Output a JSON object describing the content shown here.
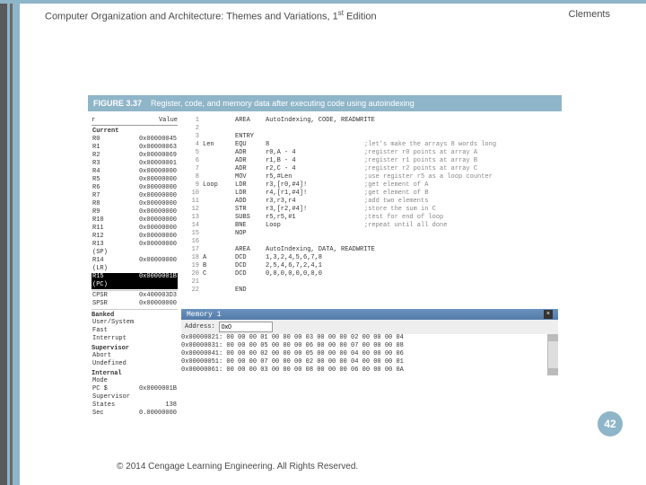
{
  "header": {
    "title_pre": "Computer Organization and Architecture: Themes and Variations, 1",
    "title_post": " Edition",
    "sup": "st",
    "author": "Clements"
  },
  "figure": {
    "number": "FIGURE 3.37",
    "caption": "Register, code, and memory data after executing code using autoindexing"
  },
  "registers": {
    "header_left": "r",
    "header_right": "Value",
    "group": "Current",
    "rows": [
      {
        "n": "R0",
        "v": "0x00000045"
      },
      {
        "n": "R1",
        "v": "0x00000063"
      },
      {
        "n": "R2",
        "v": "0x00000069"
      },
      {
        "n": "R3",
        "v": "0x00000001"
      },
      {
        "n": "R4",
        "v": "0x00000000"
      },
      {
        "n": "R5",
        "v": "0x00000000"
      },
      {
        "n": "R6",
        "v": "0x00000000"
      },
      {
        "n": "R7",
        "v": "0x00000000"
      },
      {
        "n": "R8",
        "v": "0x00000000"
      },
      {
        "n": "R9",
        "v": "0x00000000"
      },
      {
        "n": "R10",
        "v": "0x00000000"
      },
      {
        "n": "R11",
        "v": "0x00000000"
      },
      {
        "n": "R12",
        "v": "0x00000000"
      },
      {
        "n": "R13 (SP)",
        "v": "0x00000000"
      },
      {
        "n": "R14 (LR)",
        "v": "0x00000000"
      }
    ],
    "hl_row": {
      "n": "R15 (PC)",
      "v": "0x0000001B"
    },
    "cpsr": {
      "n": "CPSR",
      "v": "0x400003D3"
    },
    "spsr": {
      "n": "SPSR",
      "v": "0x00000000"
    },
    "banked": "Banked",
    "usersys": "User/System",
    "fastint": "Fast Interrupt",
    "supervisor_hdr": "Supervisor",
    "abort": "Abort",
    "undef": "Undefined",
    "internal": "Internal",
    "int_rows": [
      {
        "n": "Mode",
        "v": ""
      },
      {
        "n": "PC $",
        "v": "0x0000001B"
      },
      {
        "n": "Supervisor",
        "v": ""
      },
      {
        "n": "States",
        "v": "138"
      },
      {
        "n": "Sec",
        "v": "0.00000000"
      }
    ]
  },
  "line_nums": [
    "1",
    "2",
    "3",
    "4",
    "5",
    "6",
    "7",
    "8",
    "9",
    "10",
    "11",
    "12",
    "13",
    "14",
    "15",
    "16",
    "17",
    "18",
    "19",
    "20",
    "21",
    "22"
  ],
  "code": [
    {
      "lbl": "",
      "mn": "AREA",
      "op": "AutoIndexing, CODE, READWRITE",
      "cm": ""
    },
    {
      "lbl": "",
      "mn": "",
      "op": "",
      "cm": ""
    },
    {
      "lbl": "",
      "mn": "ENTRY",
      "op": "",
      "cm": ""
    },
    {
      "lbl": "Len",
      "mn": "EQU",
      "op": "8",
      "cm": ";let's make the arrays 8 words long"
    },
    {
      "lbl": "",
      "mn": "ADR",
      "op": "r0,A - 4",
      "cm": ";register r0 points at array A"
    },
    {
      "lbl": "",
      "mn": "ADR",
      "op": "r1,B - 4",
      "cm": ";register r1 points at array B"
    },
    {
      "lbl": "",
      "mn": "ADR",
      "op": "r2,C - 4",
      "cm": ";register r2 points at array C"
    },
    {
      "lbl": "",
      "mn": "MOV",
      "op": "r5,#Len",
      "cm": ";use register r5 as a loop counter"
    },
    {
      "lbl": "Loop",
      "mn": "LDR",
      "op": "r3,[r0,#4]!",
      "cm": ";get element of A"
    },
    {
      "lbl": "",
      "mn": "LDR",
      "op": "r4,[r1,#4]!",
      "cm": ";get element of B"
    },
    {
      "lbl": "",
      "mn": "ADD",
      "op": "r3,r3,r4",
      "cm": ";add two elements"
    },
    {
      "lbl": "",
      "mn": "STR",
      "op": "r3,[r2,#4]!",
      "cm": ";store the sum in C"
    },
    {
      "lbl": "",
      "mn": "SUBS",
      "op": "r5,r5,#1",
      "cm": ";test for end of loop"
    },
    {
      "lbl": "",
      "mn": "BNE",
      "op": "Loop",
      "cm": ";repeat until all done"
    },
    {
      "lbl": "",
      "mn": "NOP",
      "op": "",
      "cm": ""
    },
    {
      "lbl": "",
      "mn": "",
      "op": "",
      "cm": ""
    },
    {
      "lbl": "",
      "mn": "AREA",
      "op": "AutoIndexing, DATA, READWRITE",
      "cm": ""
    },
    {
      "lbl": "A",
      "mn": "DCD",
      "op": "1,3,2,4,5,6,7,8",
      "cm": ""
    },
    {
      "lbl": "B",
      "mn": "DCD",
      "op": "2,5,4,6,7,2,4,1",
      "cm": ""
    },
    {
      "lbl": "C",
      "mn": "DCD",
      "op": "0,0,0,0,0,0,0,0",
      "cm": ""
    },
    {
      "lbl": "",
      "mn": "",
      "op": "",
      "cm": ""
    },
    {
      "lbl": "",
      "mn": "END",
      "op": "",
      "cm": ""
    }
  ],
  "memory": {
    "title": "Memory 1",
    "addr_label": "Address:",
    "addr_value": "0x0",
    "rows": [
      "0x00000021: 00 00 00 01 00 00 00 03 00 00 00 02 00 00 00 04",
      "0x00000031: 00 00 00 05 00 00 00 06 00 00 00 07 00 00 00 08",
      "0x00000041: 00 00 00 02 00 00 00 05 00 00 00 04 00 00 00 06",
      "0x00000051: 00 00 00 07 00 00 00 02 00 00 00 04 00 00 00 01",
      "0x00000061: 00 00 00 03 00 00 00 08 00 00 00 06 00 00 00 0A"
    ]
  },
  "page_number": "42",
  "copyright": "© 2014 Cengage Learning Engineering. All Rights Reserved."
}
